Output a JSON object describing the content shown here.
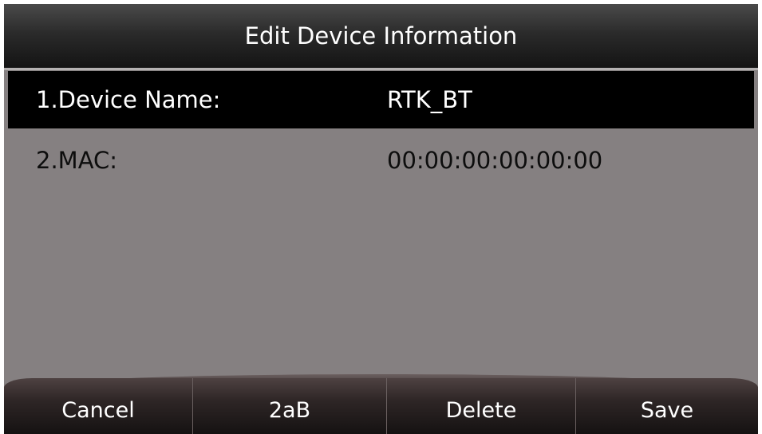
{
  "header": {
    "title": "Edit Device Information"
  },
  "rows": [
    {
      "label": "1.Device Name:",
      "value": "RTK_BT",
      "selected": true
    },
    {
      "label": "2.MAC:",
      "value": "00:00:00:00:00:00",
      "selected": false
    }
  ],
  "softkeys": {
    "cancel": "Cancel",
    "input_mode": "2aB",
    "delete": "Delete",
    "save": "Save"
  },
  "colors": {
    "background": "#858081",
    "selected_row": "#000000",
    "title_bar": "#2b2b2b"
  }
}
